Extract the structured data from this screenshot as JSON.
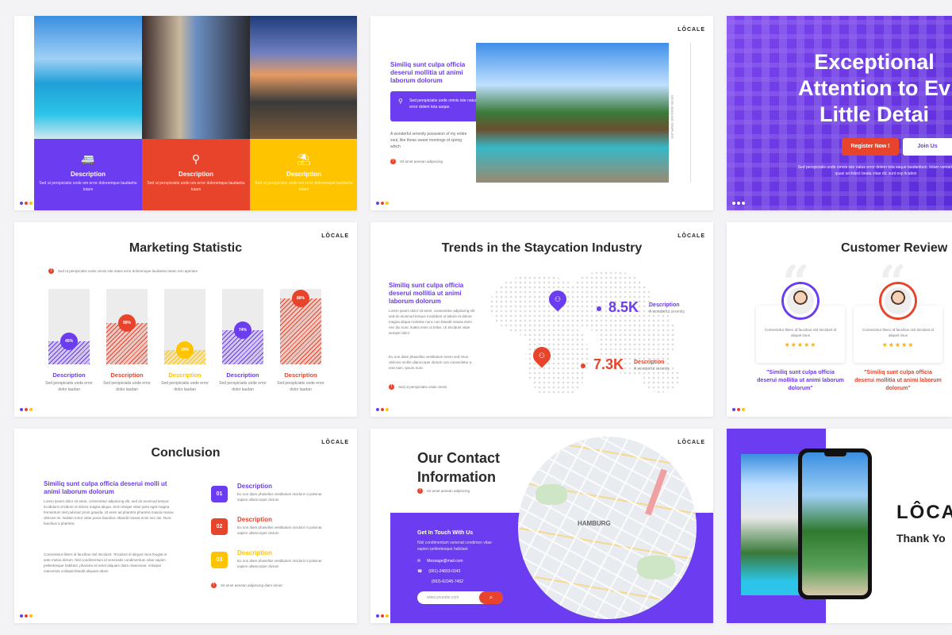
{
  "brand": {
    "logo": "LÔCALE",
    "purple": "#6b3cf0",
    "red": "#e8442c",
    "yellow": "#ffc400"
  },
  "slide1": {
    "categories": [
      {
        "title": "Description",
        "text": "Sed ut perspiciatis unde om error doloremque laudantiu totam"
      },
      {
        "title": "Description",
        "text": "Sed ut perspiciatis unde om error doloremque laudantiu totam"
      },
      {
        "title": "Description",
        "text": "Sed ut perspiciatis unde om error doloremque laudantiu totam"
      }
    ]
  },
  "slide2": {
    "heading": "Similiq sunt culpa officia deserui mollitia ut animi laborum dolorum",
    "box_text": "Sed perspiciatis unde omnis iste natus error dolem tota saque.",
    "body": "A wonderful serenity possesion of my entire soul, like these sweet mornings of spring which",
    "note": "Sit amet aenean adipiscing",
    "vertical_text": "HOTEL BOOKING TEMPLATE"
  },
  "slide3": {
    "headline": [
      "Exceptional",
      "Attention to Ev",
      "Little Detai"
    ],
    "register": "Register Now !",
    "join": "Join Us",
    "caption": "Sed perspiciatis unde omnis iste natus error dolem tota saque laudantium, totam ventatis quasi architect beata vitae dic sunt exp lication"
  },
  "slide4": {
    "title": "Marketing Statistic",
    "note": "Sed ut perspiciatis unde omnis iste natus error doloremque laudantiu totam rem aperiam",
    "caption_text": "Sed perspiciatis unde error dolor laudan"
  },
  "chart_data": {
    "type": "bar",
    "title": "Marketing Statistic",
    "categories": [
      "Description",
      "Description",
      "Description",
      "Description",
      "Description"
    ],
    "values": [
      45,
      89,
      20,
      74,
      88
    ],
    "ylim": [
      0,
      100
    ]
  },
  "slide5": {
    "title": "Trends in the Staycation Industry",
    "heading": "Similiq sunt culpa officia deserui mollitia ut animi laborum dolorum",
    "para1": "Lorem ipsum dolor sit amet, consectetur adipiscing elit sed do eiusmod tempor incididunt ut labore et dolore magna aliqua molestie nunc non blandit massa enim nec dui nunc mattis enim ut tellus. Ut tincidunt vitae semper dolor",
    "para2": "Eu non diam phasellus vestibulum lorem sed risus ultricies mollis ullamcorper dictum non consectetur a erat nam. Ipsum nunc",
    "note": "Sed ut perspiciatis unde omnis",
    "stat1_value": "8.5K",
    "stat1_label": "Description",
    "stat1_sub": "A wonderful serenity",
    "stat2_value": "7.3K",
    "stat2_label": "Description",
    "stat2_sub": "A wonderful serenity"
  },
  "slide6": {
    "title": "Customer Review",
    "reviews": [
      {
        "text": "Consectetur libero id faucibus nisl tincidunt id aliquet risus",
        "stars": "★★★★★",
        "quote": "\"Similiq sunt culpa officia deserui mollitia ut animi laborum dolorum\""
      },
      {
        "text": "Consectetur libero id faucibus nisl tincidunt id aliquet risus",
        "stars": "★★★★★",
        "quote": "\"Similiq sunt culpa officia deserui mollitia ut animi laborum dolorum\""
      }
    ]
  },
  "slide7": {
    "title": "Conclusion",
    "heading": "Similiq sunt culpa officia deserui molli ut animi laborum dolorum",
    "para1": "Lorem ipsum dolor sit amet, consectetur adipiscing elit, sed do eiusmod tempor incididunt ut labore et dolore magna aliqua. Sem integer vitae justo eget magna fermentum sed pulvinar proin gravida. Ut enim ad pharetra pharetra massa massa ultricies mi. Nullam tortor vitae purus faucibus. Blandit massa enim nec dui. Nunc faucibus a pharetra",
    "para2": "Consectetur libero id faucibus nisl tincidunt. Tincidunt id aliquet risus feugiat in ante metus dictum. Nisl condimentum id venenatis condimentum vitae sapien pellentesque habitant. pharetra sit amet aliquam diam maecenas. Volutpat maecenas volutpat blandit aliquam etiam",
    "items": [
      {
        "num": "01",
        "title": "Description",
        "text": "Eu non diam phasellus vestibulum nicidunt ni pulvinar sapien ullamcorper dictum"
      },
      {
        "num": "02",
        "title": "Description",
        "text": "Eu non diam phasellus vestibulum nicidunt ni pulvinar sapien ullamcorper dictum"
      },
      {
        "num": "03",
        "title": "Description",
        "text": "Eu non diam phasellus vestibulum nicidunt ni pulvinar sapien ullamcorper dictum"
      }
    ],
    "note": "Sit amet aenean adipiscing diam donec"
  },
  "slide8": {
    "title_line1": "Our Contact",
    "title_line2": "Information",
    "note": "Sit amet aenean adipiscing",
    "panel_title": "Get In Touch With Us",
    "panel_text": "Nisl condimentum venenat condimen vitae sapien pellentesque habitant",
    "email": "Message@mail.com",
    "phone1": "(001)-24833-0343",
    "phone2": "(002)-62345-7452",
    "search_placeholder": "www.yoursite.com",
    "map_label": "HAMBURG"
  },
  "slide9": {
    "logo": "LÔCA",
    "thanks": "Thank Yo"
  }
}
